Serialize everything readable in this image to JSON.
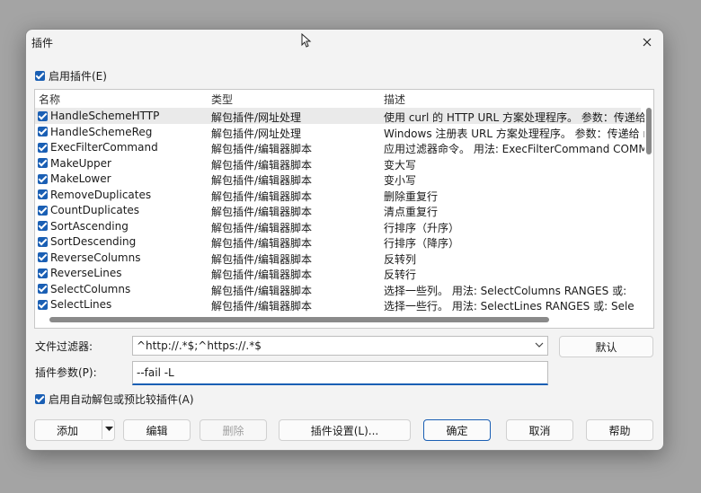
{
  "window": {
    "title": "插件"
  },
  "enable_plugins_label": "启用插件(E)",
  "columns": {
    "name": "名称",
    "type": "类型",
    "desc": "描述"
  },
  "plugins": [
    {
      "name": "HandleSchemeHTTP",
      "type": "解包插件/网址处理",
      "desc": "使用 curl 的 HTTP URL 方案处理程序。 参数：传递给 c"
    },
    {
      "name": "HandleSchemeReg",
      "type": "解包插件/网址处理",
      "desc": "Windows 注册表 URL 方案处理程序。 参数：传递给 re"
    },
    {
      "name": "ExecFilterCommand",
      "type": "解包插件/编辑器脚本",
      "desc": "应用过滤器命令。 用法: ExecFilterCommand COMMA"
    },
    {
      "name": "MakeUpper",
      "type": "解包插件/编辑器脚本",
      "desc": "变大写"
    },
    {
      "name": "MakeLower",
      "type": "解包插件/编辑器脚本",
      "desc": "变小写"
    },
    {
      "name": "RemoveDuplicates",
      "type": "解包插件/编辑器脚本",
      "desc": "删除重复行"
    },
    {
      "name": "CountDuplicates",
      "type": "解包插件/编辑器脚本",
      "desc": "清点重复行"
    },
    {
      "name": "SortAscending",
      "type": "解包插件/编辑器脚本",
      "desc": "行排序（升序）"
    },
    {
      "name": "SortDescending",
      "type": "解包插件/编辑器脚本",
      "desc": "行排序（降序）"
    },
    {
      "name": "ReverseColumns",
      "type": "解包插件/编辑器脚本",
      "desc": "反转列"
    },
    {
      "name": "ReverseLines",
      "type": "解包插件/编辑器脚本",
      "desc": "反转行"
    },
    {
      "name": "SelectColumns",
      "type": "解包插件/编辑器脚本",
      "desc": "选择一些列。 用法:    SelectColumns RANGES     或:"
    },
    {
      "name": "SelectLines",
      "type": "解包插件/编辑器脚本",
      "desc": "选择一些行。 用法:    SelectLines RANGES     或:    Sele"
    }
  ],
  "file_filter": {
    "label": "文件过滤器:",
    "value": "^http://.*$;^https://.*$"
  },
  "default_button": "默认",
  "plugin_args": {
    "label": "插件参数(P):",
    "value": "--fail -L"
  },
  "auto_unpack_label": "启用自动解包或预比较插件(A)",
  "buttons": {
    "add": "添加",
    "edit": "编辑",
    "delete": "删除",
    "settings": "插件设置(L)...",
    "ok": "确定",
    "cancel": "取消",
    "help": "帮助"
  }
}
